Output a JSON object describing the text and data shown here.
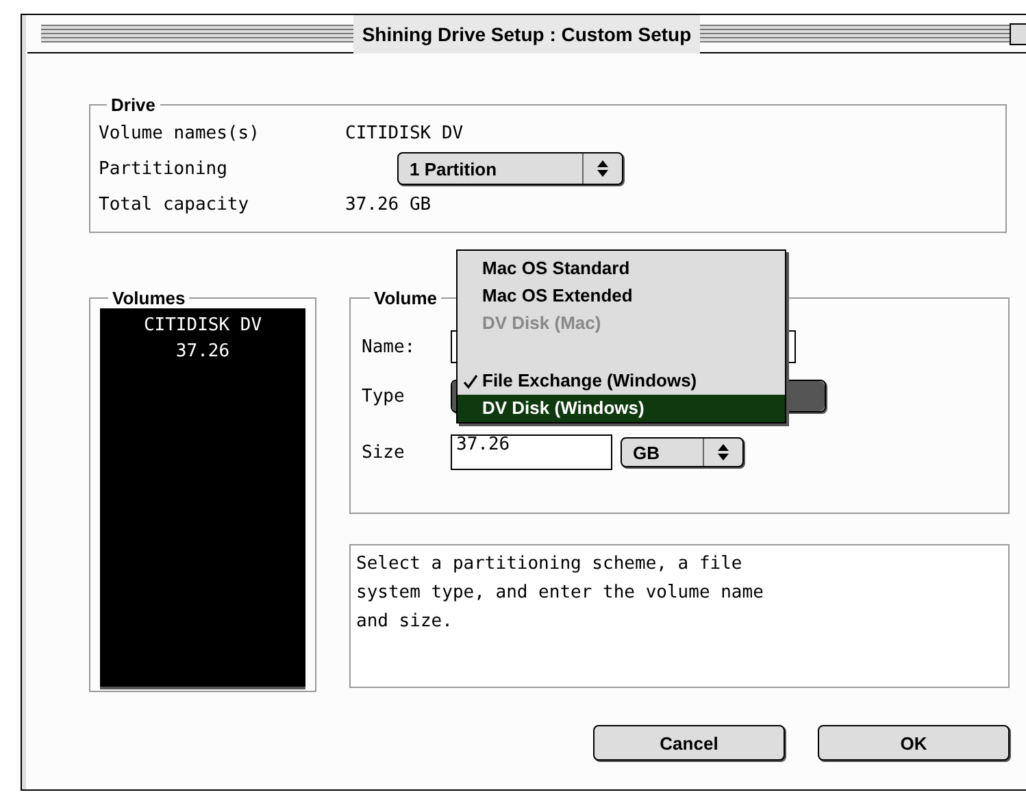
{
  "window": {
    "title": "Shining Drive Setup : Custom Setup"
  },
  "drive": {
    "title": "Drive",
    "rows": [
      {
        "label": "Volume names(s)",
        "kind": "text",
        "value": "CITIDISK DV"
      },
      {
        "label": "Partitioning",
        "kind": "popup",
        "value": "1 Partition"
      },
      {
        "label": "Total capacity",
        "kind": "text",
        "value": "37.26 GB"
      }
    ]
  },
  "volumes": {
    "title": "Volumes",
    "items": [
      {
        "name": "CITIDISK DV",
        "size": "37.26"
      }
    ]
  },
  "volume": {
    "title": "Volume",
    "name_label": "Name:",
    "type_label": "Type",
    "size_label": "Size",
    "size_value": "37.26",
    "unit": "GB"
  },
  "help_text": "Select a partitioning scheme, a file system type, and enter the volume name and size.",
  "buttons": [
    {
      "label": "Cancel"
    },
    {
      "label": "OK"
    }
  ],
  "type_menu": {
    "items": [
      {
        "kind": "item",
        "label": "Mac OS Standard",
        "disabled": false,
        "checked": false,
        "selected": false
      },
      {
        "kind": "item",
        "label": "Mac OS Extended",
        "disabled": false,
        "checked": false,
        "selected": false
      },
      {
        "kind": "item",
        "label": "DV Disk (Mac)",
        "disabled": true,
        "checked": false,
        "selected": false
      },
      {
        "kind": "gap"
      },
      {
        "kind": "item",
        "label": "File Exchange (Windows)",
        "disabled": false,
        "checked": true,
        "selected": false
      },
      {
        "kind": "item",
        "label": "DV Disk (Windows)",
        "disabled": false,
        "checked": false,
        "selected": true
      }
    ]
  }
}
